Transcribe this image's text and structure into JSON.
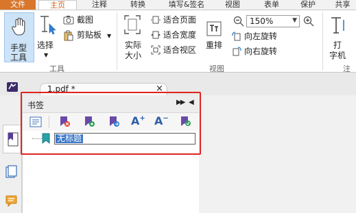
{
  "menu": {
    "tabs": [
      "文件",
      "主页",
      "注释",
      "转换",
      "填写&签名",
      "视图",
      "表单",
      "保护",
      "共享"
    ]
  },
  "ribbon": {
    "hand_tool": [
      "手型",
      "工具"
    ],
    "select": "选择",
    "screenshot": "截图",
    "clipboard": "剪贴板",
    "group_tools": "工具",
    "actual_size": [
      "实际",
      "大小"
    ],
    "fit_page": "适合页面",
    "fit_width": "适合宽度",
    "fit_visible": "适合视区",
    "reflow": "重排",
    "zoom_value": "150%",
    "rotate_left": "向左旋转",
    "rotate_right": "向右旋转",
    "group_view": "视图",
    "typewriter": [
      "打",
      "字机"
    ],
    "group_comment": "注释"
  },
  "doc_tab": {
    "title": "1.pdf *"
  },
  "bookmark_panel": {
    "title": "书签",
    "bookmark_text": "无标题"
  },
  "colors": {
    "accent": "#d8762b",
    "highlight": "#e0231f",
    "selection": "#3a78c8"
  }
}
